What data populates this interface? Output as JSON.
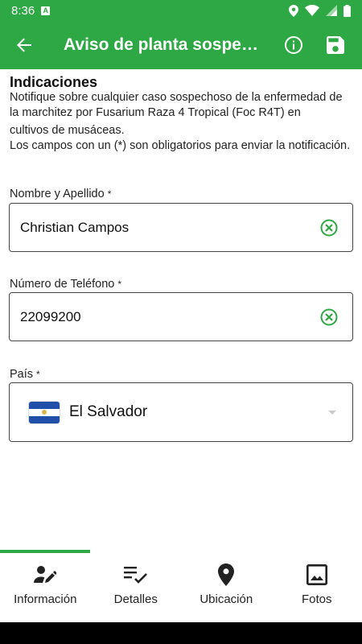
{
  "status_bar": {
    "time": "8:36",
    "badge": "A"
  },
  "app_bar": {
    "title": "Aviso de planta sospechosa",
    "accent": "#2ea844"
  },
  "intro": {
    "heading": "Indicaciones",
    "line1": "Notifique sobre cualquier caso sospechoso de la enfermedad de la marchitez por Fusarium Raza 4 Tropical (Foc R4T) en",
    "line2": "cultivos de musáceas.",
    "line3": "Los campos con un (*) son obligatorios para enviar la notificación."
  },
  "fields": {
    "name": {
      "label": "Nombre y Apellido",
      "required": "*",
      "value": "Christian Campos"
    },
    "phone": {
      "label": "Número de Teléfono",
      "required": "*",
      "value": "22099200"
    },
    "country": {
      "label": "País",
      "required": "*",
      "value": "El Salvador"
    }
  },
  "bottom_nav": {
    "tabs": [
      {
        "label": "Información",
        "icon": "edit-person-icon"
      },
      {
        "label": "Detalles",
        "icon": "checklist-icon"
      },
      {
        "label": "Ubicación",
        "icon": "location-pin-icon"
      },
      {
        "label": "Fotos",
        "icon": "image-icon"
      }
    ]
  }
}
